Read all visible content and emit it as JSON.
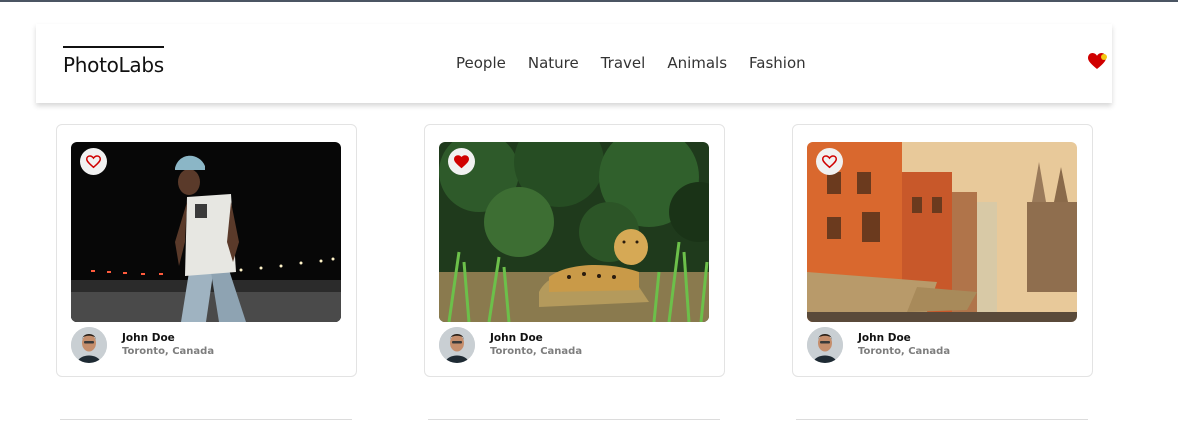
{
  "app": {
    "logo": "PhotoLabs"
  },
  "nav": {
    "topics": [
      "People",
      "Nature",
      "Travel",
      "Animals",
      "Fashion"
    ],
    "fav_icon": "heart-with-notification-dot-icon"
  },
  "colors": {
    "heart": "#d00000",
    "notification": "#f2c811",
    "muted_text": "#7d7d7d"
  },
  "photos": [
    {
      "liked": false,
      "user": {
        "name": "John Doe",
        "location": "Toronto, Canada"
      },
      "alt": "person-night-street"
    },
    {
      "liked": true,
      "user": {
        "name": "John Doe",
        "location": "Toronto, Canada"
      },
      "alt": "jaguar-in-grass"
    },
    {
      "liked": false,
      "user": {
        "name": "John Doe",
        "location": "Toronto, Canada"
      },
      "alt": "orange-buildings-street"
    }
  ]
}
